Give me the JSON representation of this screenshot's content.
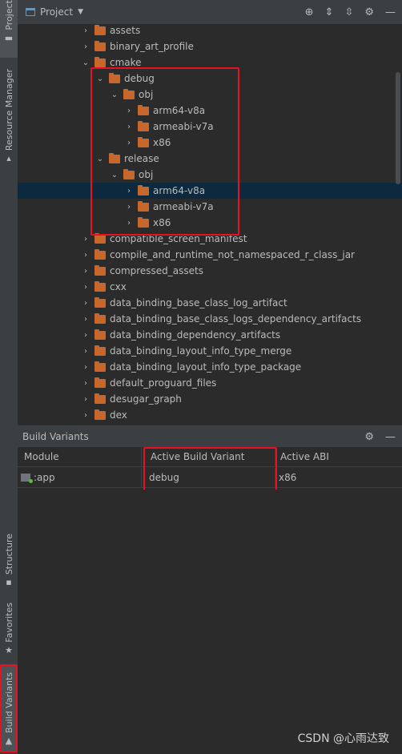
{
  "sidebar": {
    "project": "Project",
    "resource_manager": "Resource Manager",
    "structure": "Structure",
    "favorites": "Favorites",
    "build_variants": "Build Variants"
  },
  "project_panel": {
    "title": "Project",
    "tree": [
      {
        "label": "assets",
        "depth": 0,
        "expanded": false
      },
      {
        "label": "binary_art_profile",
        "depth": 0,
        "expanded": false
      },
      {
        "label": "cmake",
        "depth": 0,
        "expanded": true
      },
      {
        "label": "debug",
        "depth": 1,
        "expanded": true
      },
      {
        "label": "obj",
        "depth": 2,
        "expanded": true
      },
      {
        "label": "arm64-v8a",
        "depth": 3,
        "expanded": false
      },
      {
        "label": "armeabi-v7a",
        "depth": 3,
        "expanded": false
      },
      {
        "label": "x86",
        "depth": 3,
        "expanded": false
      },
      {
        "label": "release",
        "depth": 1,
        "expanded": true
      },
      {
        "label": "obj",
        "depth": 2,
        "expanded": true
      },
      {
        "label": "arm64-v8a",
        "depth": 3,
        "expanded": false,
        "selected": true
      },
      {
        "label": "armeabi-v7a",
        "depth": 3,
        "expanded": false
      },
      {
        "label": "x86",
        "depth": 3,
        "expanded": false
      },
      {
        "label": "compatible_screen_manifest",
        "depth": 0,
        "expanded": false
      },
      {
        "label": "compile_and_runtime_not_namespaced_r_class_jar",
        "depth": 0,
        "expanded": false
      },
      {
        "label": "compressed_assets",
        "depth": 0,
        "expanded": false
      },
      {
        "label": "cxx",
        "depth": 0,
        "expanded": false
      },
      {
        "label": "data_binding_base_class_log_artifact",
        "depth": 0,
        "expanded": false
      },
      {
        "label": "data_binding_base_class_logs_dependency_artifacts",
        "depth": 0,
        "expanded": false
      },
      {
        "label": "data_binding_dependency_artifacts",
        "depth": 0,
        "expanded": false
      },
      {
        "label": "data_binding_layout_info_type_merge",
        "depth": 0,
        "expanded": false
      },
      {
        "label": "data_binding_layout_info_type_package",
        "depth": 0,
        "expanded": false
      },
      {
        "label": "default_proguard_files",
        "depth": 0,
        "expanded": false
      },
      {
        "label": "desugar_graph",
        "depth": 0,
        "expanded": false
      },
      {
        "label": "dex",
        "depth": 0,
        "expanded": false
      }
    ]
  },
  "build_variants": {
    "title": "Build Variants",
    "columns": [
      "Module",
      "Active Build Variant",
      "Active ABI"
    ],
    "rows": [
      {
        "module": ":app",
        "variant": "debug",
        "abi": "x86"
      }
    ]
  },
  "watermark": "CSDN @心雨达致",
  "colors": {
    "folder": "#c7672c",
    "selection": "#0d293e",
    "highlight_box": "#e81123",
    "panel_bg": "#2b2b2b",
    "toolbar_bg": "#3c3f41"
  }
}
